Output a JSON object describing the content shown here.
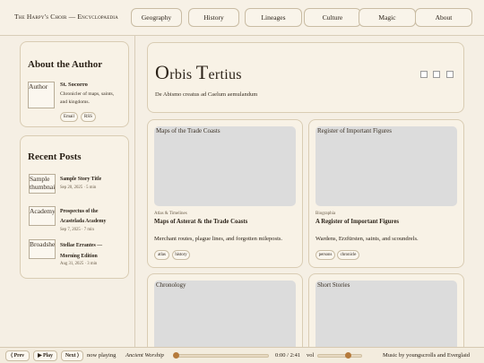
{
  "header": {
    "brand": "The Harpy's Choir — Encyclopaedia",
    "nav": [
      "Geography",
      "History",
      "Lineages",
      "Culture",
      "Magic",
      "About"
    ]
  },
  "about": {
    "title": "About the Author",
    "img_alt": "Author",
    "name": "St. Socorro",
    "desc_lines": [
      "Chronicler of maps, saints,",
      "and kingdoms."
    ],
    "links": [
      "Email",
      "RSS"
    ]
  },
  "recent": {
    "title": "Recent Posts",
    "posts": [
      {
        "alt": "Sample thumbnail",
        "title_lines": [
          "Sample Story Title"
        ],
        "meta": "Sep 20, 2025 · 5 min"
      },
      {
        "alt": "Academy",
        "title_lines": [
          "Prospectus of the",
          "Acastelada Academy"
        ],
        "meta": "Sep 7, 2025 · 7 min"
      },
      {
        "alt": "Broadsheet",
        "title_lines": [
          "Stellae Errantes —",
          "Morning Edition"
        ],
        "meta": "Aug 31, 2025 · 3 min"
      }
    ]
  },
  "hero": {
    "title_parts": [
      "O",
      "rbis ",
      "T",
      "ertius"
    ],
    "subtitle": "De Abismo creatus ad Caelum aemulandum"
  },
  "articles": [
    {
      "img_alt": "Maps of the Trade Coasts",
      "category": "Atlas & Timelines",
      "title": "Maps of Asterat & the Trade Coasts",
      "desc": "Merchant routes, plague lines, and forgotten mileposts.",
      "tags": [
        "atlas",
        "history"
      ]
    },
    {
      "img_alt": "Register of Important Figures",
      "category": "Biographia",
      "title": "A Register of Important Figures",
      "desc": "Wardens, Erzfürsten, saints, and scoundrels.",
      "tags": [
        "persons",
        "chronicle"
      ]
    },
    {
      "img_alt": "Chronology"
    },
    {
      "img_alt": "Short Stories"
    }
  ],
  "player": {
    "prev": "⟨ Prev",
    "play": "▶ Play",
    "next": "Next ⟩",
    "now_label": "now playing",
    "track": "Ancient Worship",
    "time": "0:00 / 2:41",
    "vol_label": "vol",
    "progress": 0.0,
    "volume": 0.7,
    "credit": "Music by youngscrolls and Everglaid"
  },
  "colors": {
    "accent": "#b57a3c",
    "background": "#f5efe4",
    "card": "#f8f2e6"
  }
}
